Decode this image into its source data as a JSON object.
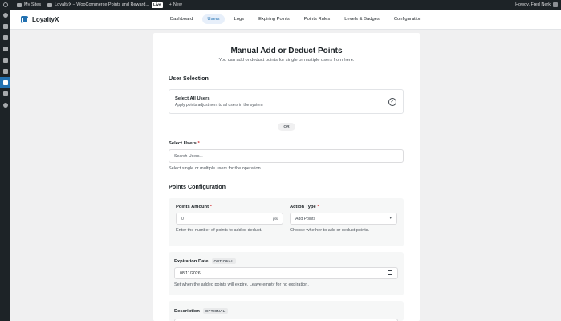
{
  "adminbar": {
    "my_sites": "My Sites",
    "site_name": "LoyaltyX – WooCommerce Points and Reward...",
    "live_badge": "Live",
    "new_label": "New",
    "howdy": "Howdy, Fred Nerk"
  },
  "plugin": {
    "name": "LoyaltyX",
    "tabs": [
      "Dashboard",
      "Users",
      "Logs",
      "Expiring Points",
      "Points Rules",
      "Levels & Badges",
      "Configuration"
    ],
    "active_tab": "Users"
  },
  "page": {
    "title": "Manual Add or Deduct Points",
    "subtitle": "You can add or deduct points for single or multiple users from here."
  },
  "user_selection": {
    "heading": "User Selection",
    "select_all_title": "Select All Users",
    "select_all_desc": "Apply points adjustment to all users in the system",
    "or_label": "OR",
    "select_users_label": "Select Users",
    "required_mark": "*",
    "search_placeholder": "Search Users...",
    "help": "Select single or multiple users for the operation."
  },
  "points_config": {
    "heading": "Points Configuration",
    "points_amount_label": "Points Amount",
    "points_amount_value": "0",
    "points_suffix": "pts",
    "points_help": "Enter the number of points to add or deduct.",
    "action_type_label": "Action Type",
    "action_type_value": "Add Points",
    "action_help": "Choose whether to add or deduct points.",
    "expiration_label": "Expiration Date",
    "optional_badge": "OPTIONAL",
    "expiration_value": "08/11/2026",
    "expiration_help": "Set when the added points will expire. Leave empty for no expiration.",
    "description_label": "Description"
  }
}
